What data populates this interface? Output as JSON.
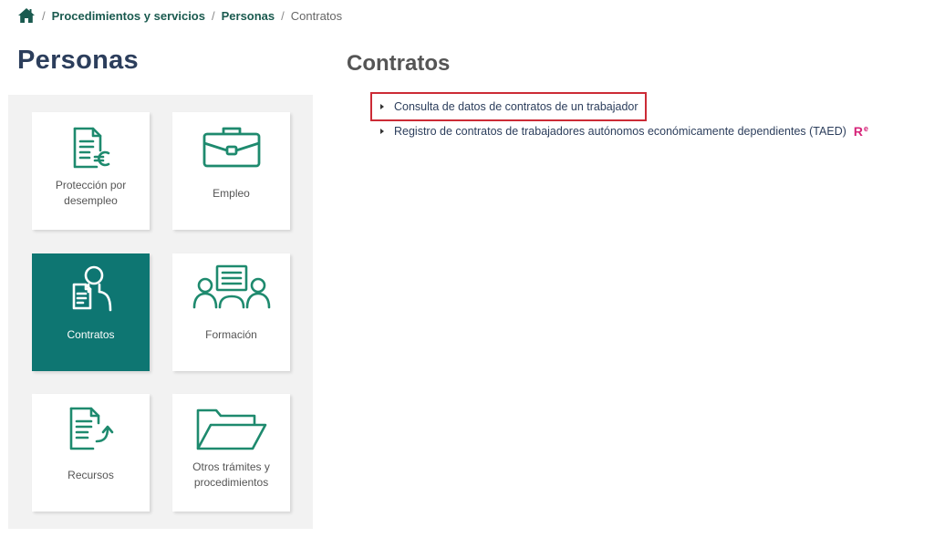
{
  "breadcrumb": {
    "items": [
      {
        "label": "Procedimientos y servicios"
      },
      {
        "label": "Personas"
      }
    ],
    "current": "Contratos",
    "separator": "/"
  },
  "sidebar": {
    "title": "Personas",
    "cards": [
      {
        "label_line1": "Protección por",
        "label_line2": "desempleo",
        "icon": "document-euro-icon"
      },
      {
        "label_line1": "Empleo",
        "icon": "briefcase-icon"
      },
      {
        "label_line1": "Contratos",
        "icon": "person-contract-icon",
        "active": true
      },
      {
        "label_line1": "Formación",
        "icon": "training-group-icon"
      },
      {
        "label_line1": "Recursos",
        "icon": "document-return-icon"
      },
      {
        "label_line1": "Otros trámites y",
        "label_line2": "procedimientos",
        "icon": "folder-icon"
      }
    ]
  },
  "main": {
    "title": "Contratos",
    "links": [
      {
        "label": "Consulta de datos de contratos de un trabajador",
        "highlighted": true
      },
      {
        "label": "Registro de contratos de trabajadores autónomos económicamente dependientes (TAED)",
        "badge": "R",
        "badge_sup": "e"
      }
    ]
  },
  "colors": {
    "accent_green": "#1e8a6e",
    "active_card": "#0e7672",
    "title_navy": "#2c3e5c",
    "highlight_red": "#cc2b36",
    "badge_pink": "#d6257a"
  }
}
